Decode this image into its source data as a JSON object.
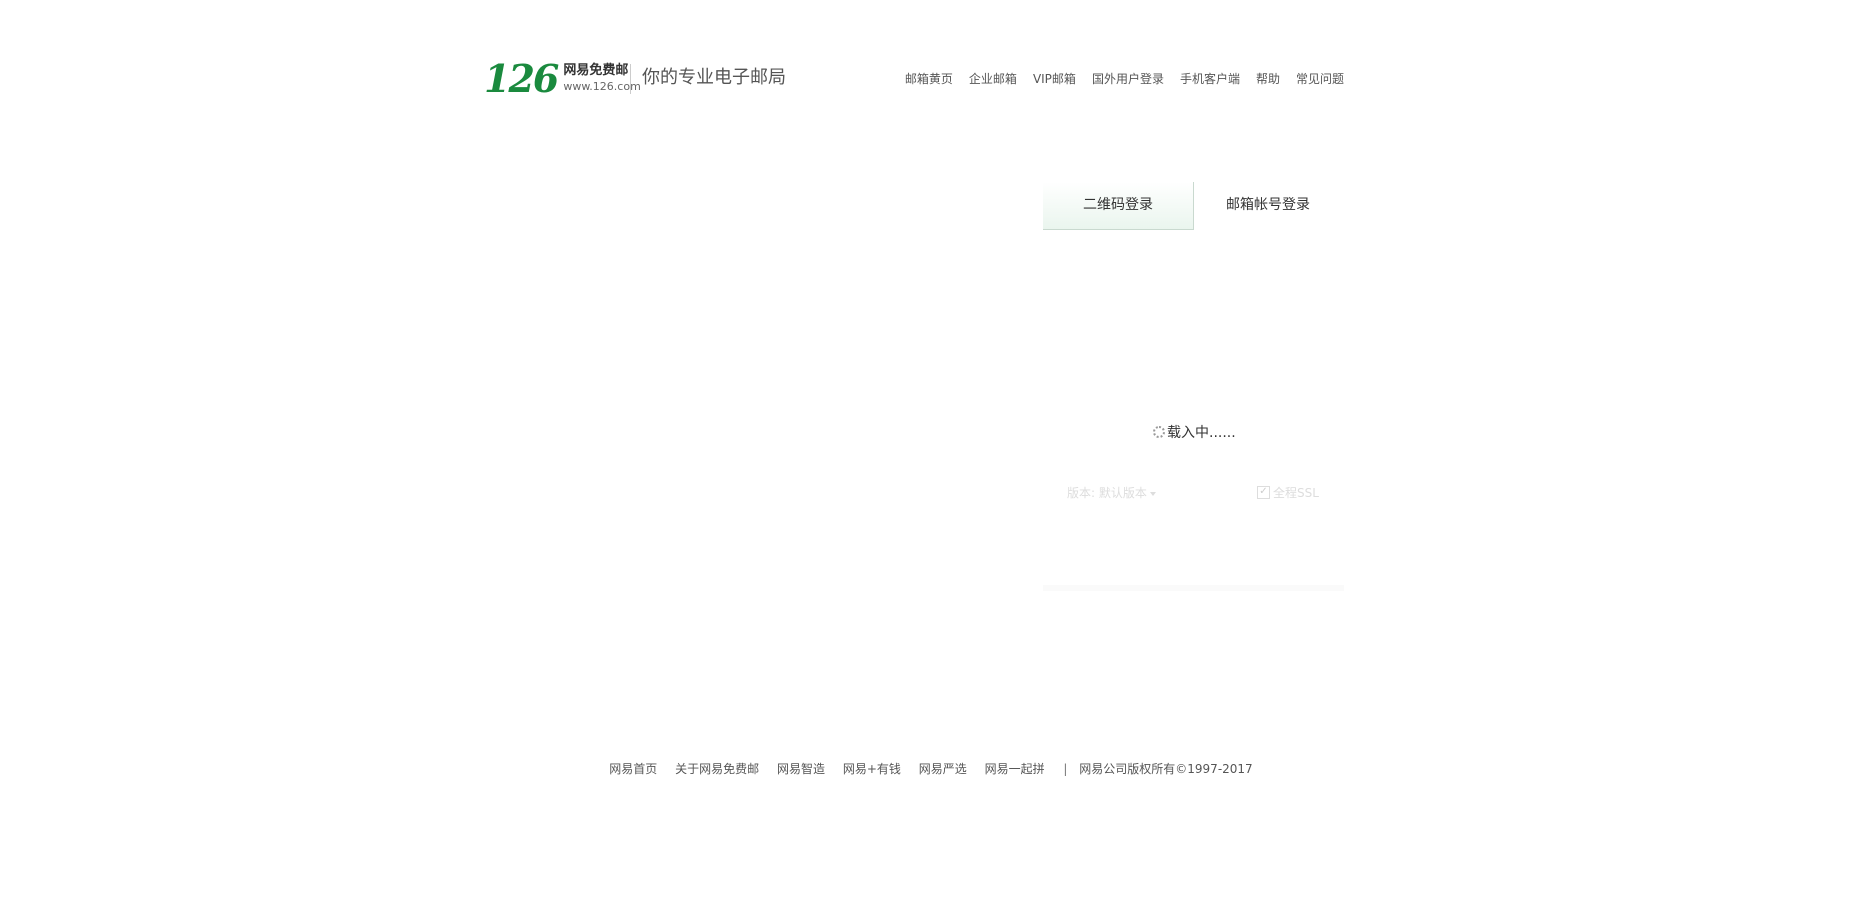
{
  "header": {
    "logo_number": "126",
    "logo_name": "网易免费邮",
    "logo_url": "www.126.com",
    "slogan": "你的专业电子邮局",
    "nav": [
      "邮箱黄页",
      "企业邮箱",
      "VIP邮箱",
      "国外用户登录",
      "手机客户端",
      "帮助",
      "常见问题"
    ]
  },
  "login": {
    "tabs": [
      "二维码登录",
      "邮箱帐号登录"
    ],
    "active_tab": "二维码登录",
    "loading_text": "载入中......",
    "version_label": "版本: 默认版本",
    "ssl_label": "全程SSL",
    "ssl_checked": true
  },
  "footer": {
    "links": [
      "网易首页",
      "关于网易免费邮",
      "网易智造",
      "网易+有钱",
      "网易严选",
      "网易一起拼"
    ],
    "separator": "|",
    "copyright": "网易公司版权所有©1997-2017"
  },
  "colors": {
    "brand_green": "#1a8a3e",
    "tab_active_bg": "#eaf5ee"
  }
}
